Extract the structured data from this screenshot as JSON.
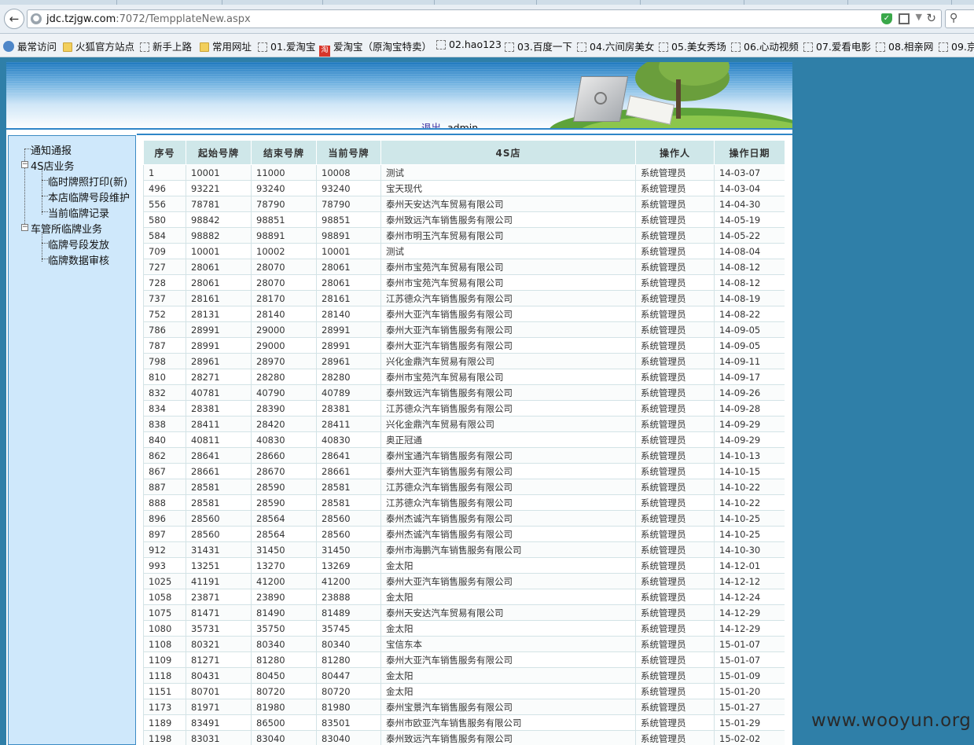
{
  "browser": {
    "url_host": "jdc.tzjgw.com",
    "url_rest": ":7072/TempplateNew.aspx",
    "bookmarks": [
      "最常访问",
      "火狐官方站点",
      "新手上路",
      "常用网址",
      "01.爱淘宝",
      "爱淘宝（原淘宝特卖）",
      "02.hao123",
      "03.百度一下",
      "04.六间房美女",
      "05.美女秀场",
      "06.心动视频",
      "07.爱看电影",
      "08.相亲网",
      "09.京"
    ]
  },
  "header": {
    "logout_label": "退出",
    "user": "admin"
  },
  "sidebar": {
    "items": [
      "通知通报",
      "4S店业务",
      "临时牌照打印(新)",
      "本店临牌号段维护",
      "当前临牌记录",
      "车管所临牌业务",
      "临牌号段发放",
      "临牌数据审核"
    ]
  },
  "table": {
    "headers": [
      "序号",
      "起始号牌",
      "结束号牌",
      "当前号牌",
      "4S店",
      "操作人",
      "操作日期"
    ],
    "rows": [
      [
        "1",
        "10001",
        "11000",
        "10008",
        "测试",
        "系统管理员",
        "14-03-07"
      ],
      [
        "496",
        "93221",
        "93240",
        "93240",
        "宝天现代",
        "系统管理员",
        "14-03-04"
      ],
      [
        "556",
        "78781",
        "78790",
        "78790",
        "泰州天安达汽车贸易有限公司",
        "系统管理员",
        "14-04-30"
      ],
      [
        "580",
        "98842",
        "98851",
        "98851",
        "泰州致远汽车销售服务有限公司",
        "系统管理员",
        "14-05-19"
      ],
      [
        "584",
        "98882",
        "98891",
        "98891",
        "泰州市明玉汽车贸易有限公司",
        "系统管理员",
        "14-05-22"
      ],
      [
        "709",
        "10001",
        "10002",
        "10001",
        "测试",
        "系统管理员",
        "14-08-04"
      ],
      [
        "727",
        "28061",
        "28070",
        "28061",
        "泰州市宝苑汽车贸易有限公司",
        "系统管理员",
        "14-08-12"
      ],
      [
        "728",
        "28061",
        "28070",
        "28061",
        "泰州市宝苑汽车贸易有限公司",
        "系统管理员",
        "14-08-12"
      ],
      [
        "737",
        "28161",
        "28170",
        "28161",
        "江苏德众汽车销售服务有限公司",
        "系统管理员",
        "14-08-19"
      ],
      [
        "752",
        "28131",
        "28140",
        "28140",
        "泰州大亚汽车销售服务有限公司",
        "系统管理员",
        "14-08-22"
      ],
      [
        "786",
        "28991",
        "29000",
        "28991",
        "泰州大亚汽车销售服务有限公司",
        "系统管理员",
        "14-09-05"
      ],
      [
        "787",
        "28991",
        "29000",
        "28991",
        "泰州大亚汽车销售服务有限公司",
        "系统管理员",
        "14-09-05"
      ],
      [
        "798",
        "28961",
        "28970",
        "28961",
        "兴化金鼎汽车贸易有限公司",
        "系统管理员",
        "14-09-11"
      ],
      [
        "810",
        "28271",
        "28280",
        "28280",
        "泰州市宝苑汽车贸易有限公司",
        "系统管理员",
        "14-09-17"
      ],
      [
        "832",
        "40781",
        "40790",
        "40789",
        "泰州致远汽车销售服务有限公司",
        "系统管理员",
        "14-09-26"
      ],
      [
        "834",
        "28381",
        "28390",
        "28381",
        "江苏德众汽车销售服务有限公司",
        "系统管理员",
        "14-09-28"
      ],
      [
        "838",
        "28411",
        "28420",
        "28411",
        "兴化金鼎汽车贸易有限公司",
        "系统管理员",
        "14-09-29"
      ],
      [
        "840",
        "40811",
        "40830",
        "40830",
        "奥正冠通",
        "系统管理员",
        "14-09-29"
      ],
      [
        "862",
        "28641",
        "28660",
        "28641",
        "泰州宝通汽车销售服务有限公司",
        "系统管理员",
        "14-10-13"
      ],
      [
        "867",
        "28661",
        "28670",
        "28661",
        "泰州大亚汽车销售服务有限公司",
        "系统管理员",
        "14-10-15"
      ],
      [
        "887",
        "28581",
        "28590",
        "28581",
        "江苏德众汽车销售服务有限公司",
        "系统管理员",
        "14-10-22"
      ],
      [
        "888",
        "28581",
        "28590",
        "28581",
        "江苏德众汽车销售服务有限公司",
        "系统管理员",
        "14-10-22"
      ],
      [
        "896",
        "28560",
        "28564",
        "28560",
        "泰州杰诚汽车销售服务有限公司",
        "系统管理员",
        "14-10-25"
      ],
      [
        "897",
        "28560",
        "28564",
        "28560",
        "泰州杰诚汽车销售服务有限公司",
        "系统管理员",
        "14-10-25"
      ],
      [
        "912",
        "31431",
        "31450",
        "31450",
        "泰州市海鹏汽车销售服务有限公司",
        "系统管理员",
        "14-10-30"
      ],
      [
        "993",
        "13251",
        "13270",
        "13269",
        "金太阳",
        "系统管理员",
        "14-12-01"
      ],
      [
        "1025",
        "41191",
        "41200",
        "41200",
        "泰州大亚汽车销售服务有限公司",
        "系统管理员",
        "14-12-12"
      ],
      [
        "1058",
        "23871",
        "23890",
        "23888",
        "金太阳",
        "系统管理员",
        "14-12-24"
      ],
      [
        "1075",
        "81471",
        "81490",
        "81489",
        "泰州天安达汽车贸易有限公司",
        "系统管理员",
        "14-12-29"
      ],
      [
        "1080",
        "35731",
        "35750",
        "35745",
        "金太阳",
        "系统管理员",
        "14-12-29"
      ],
      [
        "1108",
        "80321",
        "80340",
        "80340",
        "宝信东本",
        "系统管理员",
        "15-01-07"
      ],
      [
        "1109",
        "81271",
        "81280",
        "81280",
        "泰州大亚汽车销售服务有限公司",
        "系统管理员",
        "15-01-07"
      ],
      [
        "1118",
        "80431",
        "80450",
        "80447",
        "金太阳",
        "系统管理员",
        "15-01-09"
      ],
      [
        "1151",
        "80701",
        "80720",
        "80720",
        "金太阳",
        "系统管理员",
        "15-01-20"
      ],
      [
        "1173",
        "81971",
        "81980",
        "81980",
        "泰州宝景汽车销售服务有限公司",
        "系统管理员",
        "15-01-27"
      ],
      [
        "1189",
        "83491",
        "86500",
        "83501",
        "泰州市欧亚汽车销售服务有限公司",
        "系统管理员",
        "15-01-29"
      ],
      [
        "1198",
        "83031",
        "83040",
        "83040",
        "泰州致远汽车销售服务有限公司",
        "系统管理员",
        "15-02-02"
      ]
    ]
  },
  "watermark": "www.wooyun.org"
}
